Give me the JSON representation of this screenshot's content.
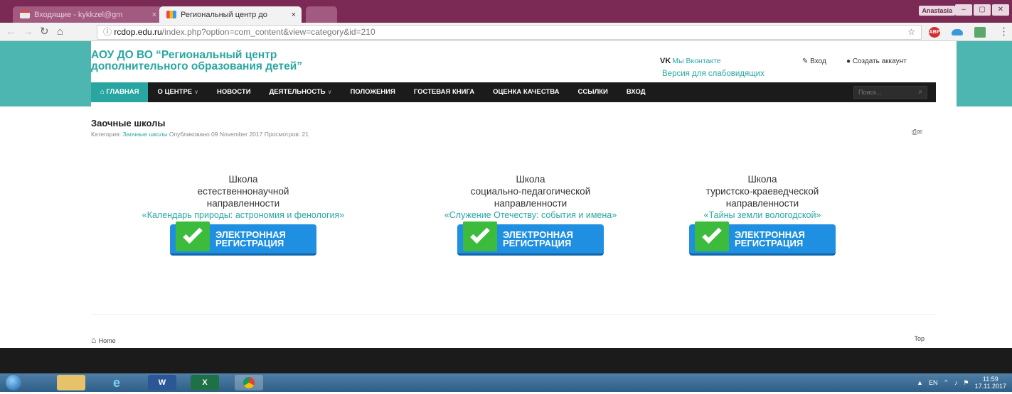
{
  "browser": {
    "tabs": [
      {
        "label": "Входящие - kykkzel@gm",
        "close": "×"
      },
      {
        "label": "Региональный центр до",
        "close": "×"
      }
    ],
    "user_button": "Anastasia",
    "window_controls": [
      "–",
      "▢",
      "✕"
    ],
    "url_domain": "rcdop.edu.ru",
    "url_path": "/index.php?option=com_content&view=category&id=210",
    "extensions": [
      {
        "name": "abp-icon",
        "text": "ABP",
        "color": "#d32f2f"
      },
      {
        "name": "cloud-icon",
        "text": "",
        "color": "#3a9ad9"
      },
      {
        "name": "translate-icon",
        "text": "",
        "color": "#5aa86a"
      }
    ]
  },
  "site": {
    "title_line1": "АОУ ДО ВО “Региональный центр",
    "title_line2": "дополнительного образования детей”",
    "vk_logo": "VK",
    "vk_text": "Мы Вконтакте",
    "low_vision": "Версия для слабовидящих",
    "login": "Вход",
    "signup": "Создать аккаунт",
    "nav": [
      {
        "label": "ГЛАВНАЯ",
        "active": true,
        "caret": false
      },
      {
        "label": "О ЦЕНТРЕ",
        "active": false,
        "caret": true
      },
      {
        "label": "НОВОСТИ",
        "active": false,
        "caret": false
      },
      {
        "label": "ДЕЯТЕЛЬНОСТЬ",
        "active": false,
        "caret": true
      },
      {
        "label": "ПОЛОЖЕНИЯ",
        "active": false,
        "caret": false
      },
      {
        "label": "ГОСТЕВАЯ КНИГА",
        "active": false,
        "caret": false
      },
      {
        "label": "ОЦЕНКА КАЧЕСТВА",
        "active": false,
        "caret": false
      },
      {
        "label": "ССЫЛКИ",
        "active": false,
        "caret": false
      },
      {
        "label": "ВХОД",
        "active": false,
        "caret": false
      }
    ],
    "search_placeholder": "Поиск..."
  },
  "article": {
    "title": "Заочные школы",
    "category_label": "Категория:",
    "category": "Заочные школы",
    "published": "Опубликовано 09 November 2017",
    "views": "Просмотров: 21"
  },
  "schools": [
    {
      "l1": "Школа",
      "l2": "естественнонаучной",
      "l3": "направленности",
      "program": "«Календарь природы: астрономия и фенология»"
    },
    {
      "l1": "Школа",
      "l2": "социально-педагогической",
      "l3": "направленности",
      "program": "«Служение Отечеству: события и имена»"
    },
    {
      "l1": "Школа",
      "l2": "туристско-краеведческой",
      "l3": "направленности",
      "program": "«Тайны земли вологодской»"
    }
  ],
  "register_button": {
    "line1": "ЭЛЕКТРОННАЯ",
    "line2": "РЕГИСТРАЦИЯ"
  },
  "footer": {
    "home": "Home",
    "top": "Top"
  },
  "taskbar": {
    "lang": "EN",
    "time": "11:59",
    "date": "17.11.2017"
  },
  "colors": {
    "accent": "#2aa6a2",
    "nav_bg": "#1b1b1b",
    "register_blue": "#1e8fe1",
    "register_green": "#3dbb3d"
  }
}
